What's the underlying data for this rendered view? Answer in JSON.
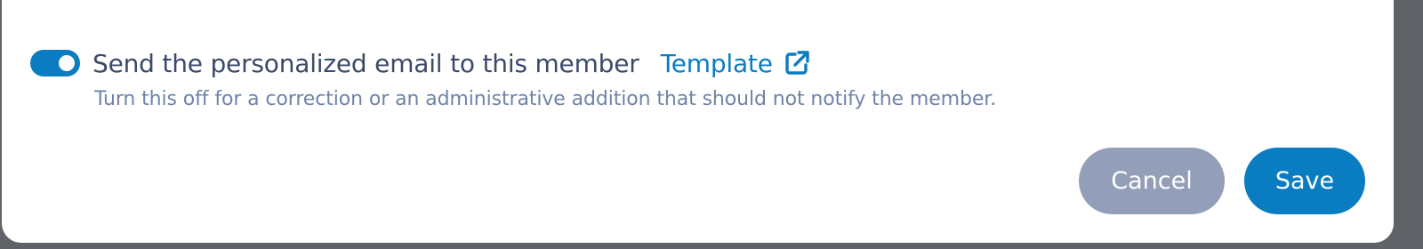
{
  "notify": {
    "toggle_on": true,
    "label": "Send the personalized email to this member",
    "template_link": "Template",
    "template_icon": "external-link-icon",
    "help": "Turn this off for a correction or an administrative addition that should not notify the member."
  },
  "actions": {
    "cancel_label": "Cancel",
    "save_label": "Save"
  },
  "colors": {
    "accent": "#0a7cc1",
    "label": "#3b4a68",
    "help": "#6f84a8",
    "cancel_bg": "#939fb8"
  }
}
